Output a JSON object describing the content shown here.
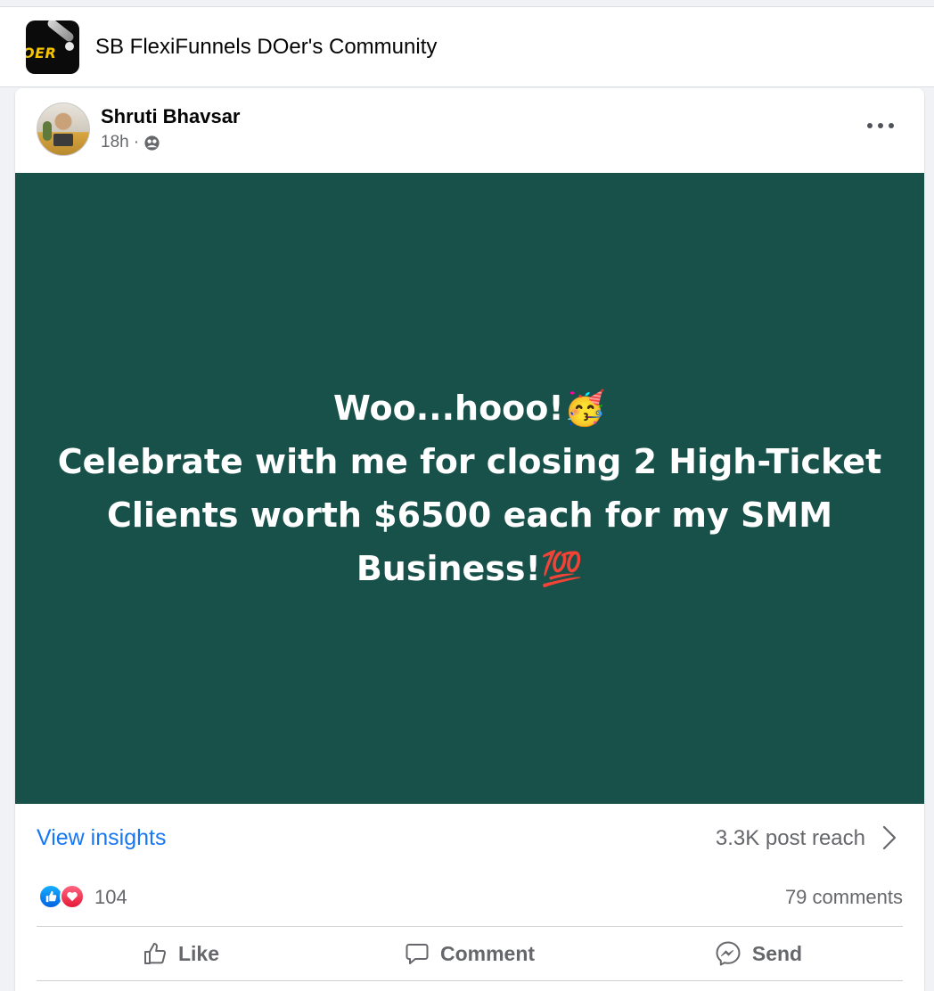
{
  "group": {
    "name": "SB FlexiFunnels DOer's Community",
    "logo_text": "OER"
  },
  "post": {
    "author": "Shruti Bhavsar",
    "time": "18h",
    "separator": "·",
    "privacy_icon": "globe-icon",
    "background_color": "#17514a",
    "text_line1": "Woo...hooo!🥳",
    "text_line2": "Celebrate with me for closing 2 High-Ticket Clients worth $6500 each for my SMM Business!💯"
  },
  "insights": {
    "link_label": "View insights",
    "reach": "3.3K post reach"
  },
  "engagement": {
    "reaction_icons": [
      "like-icon",
      "love-icon"
    ],
    "reaction_count": "104",
    "comments": "79 comments"
  },
  "actions": {
    "like": "Like",
    "comment": "Comment",
    "send": "Send"
  },
  "colors": {
    "accent": "#1877f2",
    "muted_text": "#65676b"
  }
}
